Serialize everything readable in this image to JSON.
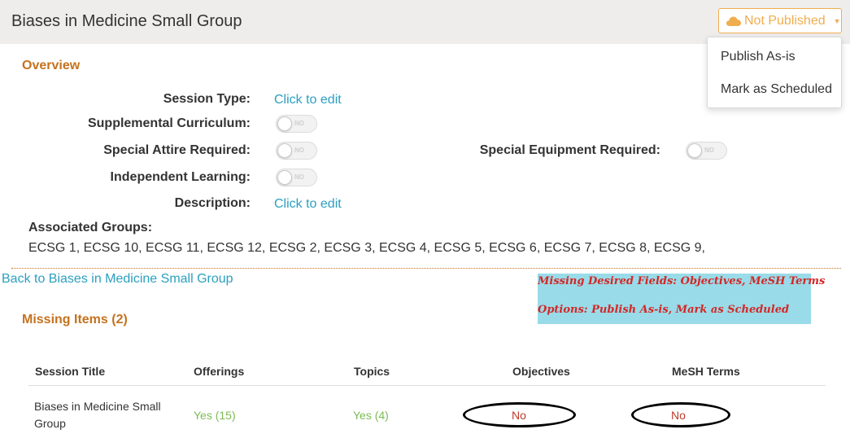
{
  "header": {
    "title": "Biases in Medicine Small Group",
    "publish_status": "Not Published"
  },
  "dropdown": {
    "items": [
      "Publish As-is",
      "Mark as Scheduled"
    ]
  },
  "overview": {
    "title": "Overview",
    "session_type_label": "Session Type:",
    "session_type_value": "Click to edit",
    "supplemental_label": "Supplemental Curriculum:",
    "special_attire_label": "Special Attire Required:",
    "special_equipment_label": "Special Equipment Required:",
    "independent_label": "Independent Learning:",
    "description_label": "Description:",
    "description_value": "Click to edit",
    "toggle_text": "NO",
    "groups_label": "Associated Groups:",
    "groups_list": "ECSG 1, ECSG 10, ECSG 11, ECSG 12, ECSG 2, ECSG 3, ECSG 4, ECSG 5, ECSG 6, ECSG 7, ECSG 8, ECSG 9,"
  },
  "back_link": "Back to Biases in Medicine Small Group",
  "annotation": {
    "line1": "Missing Desired Fields:  Objectives, MeSH Terms",
    "line2": "Options: Publish As-is, Mark as Scheduled"
  },
  "missing": {
    "title": "Missing Items (2)",
    "columns": [
      "Session Title",
      "Offerings",
      "Topics",
      "Objectives",
      "MeSH Terms"
    ],
    "rows": [
      {
        "session_title_line1": "Biases in Medicine Small",
        "session_title_line2": "Group",
        "offerings": "Yes (15)",
        "topics": "Yes (4)",
        "objectives": "No",
        "mesh_terms": "No"
      }
    ]
  },
  "colors": {
    "accent_orange": "#c5721e",
    "warning": "#f0ad4e",
    "link": "#2b9fbf",
    "yes_green": "#7cbb55",
    "no_red": "#c0392b",
    "annotation_bg": "#99dbe8"
  },
  "icons": {
    "publish_button": "cloud-icon",
    "dropdown_indicator": "caret-down-icon"
  }
}
